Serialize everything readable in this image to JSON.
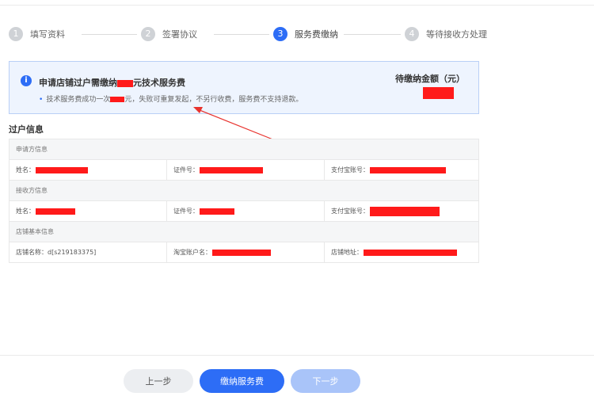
{
  "steps": [
    {
      "num": "1",
      "label": "填写资料"
    },
    {
      "num": "2",
      "label": "签署协议"
    },
    {
      "num": "3",
      "label": "服务费缴纳"
    },
    {
      "num": "4",
      "label": "等待接收方处理"
    }
  ],
  "notice": {
    "icon": "i",
    "title_pre": "申请店铺过户需缴纳",
    "title_post": "元技术服务费",
    "sub_pre": "技术服务费成功一次",
    "sub_post": "元，失败可重复发起，不另行收费，服务费不支持退款。",
    "amount_label": "待缴纳金额（元）"
  },
  "section_title": "过户信息",
  "table": {
    "applicant_header": "申请方信息",
    "receiver_header": "接收方信息",
    "shop_header": "店铺基本信息",
    "name_label": "姓名：",
    "id_label": "证件号：",
    "alipay_label": "支付宝账号：",
    "shop_name_label": "店铺名称：",
    "shop_name_value": "d[s219183375]",
    "taobao_label": "淘宝账户名：",
    "shop_addr_label": "店铺地址："
  },
  "footer": {
    "prev": "上一步",
    "pay": "缴纳服务费",
    "next": "下一步"
  },
  "colors": {
    "primary": "#2d6df6",
    "redaction": "#ff1a1a",
    "arrow": "#e8332e"
  }
}
